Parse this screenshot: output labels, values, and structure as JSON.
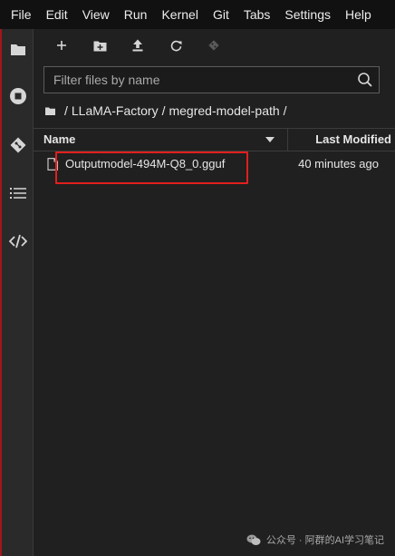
{
  "menubar": {
    "items": [
      "File",
      "Edit",
      "View",
      "Run",
      "Kernel",
      "Git",
      "Tabs",
      "Settings",
      "Help"
    ]
  },
  "sidebar": {
    "icons": [
      "folder-icon",
      "running-icon",
      "git-icon",
      "toc-icon",
      "extensions-icon"
    ]
  },
  "toolbar": {
    "icons": [
      "new-launcher-icon",
      "new-folder-icon",
      "upload-icon",
      "refresh-icon",
      "git-clone-icon"
    ]
  },
  "search": {
    "placeholder": "Filter files by name",
    "value": ""
  },
  "breadcrumb": {
    "root_icon": "folder-icon",
    "parts": [
      "LLaMA-Factory",
      "megred-model-path"
    ],
    "separator": "/"
  },
  "listing": {
    "columns": {
      "name": "Name",
      "last_modified": "Last Modified"
    },
    "files": [
      {
        "name": "Outputmodel-494M-Q8_0.gguf",
        "modified": "40 minutes ago",
        "icon": "file-icon"
      }
    ]
  },
  "colors": {
    "menubar_bg": "#111111",
    "panel_bg": "#202020",
    "sidebar_bg": "#2a2a2a",
    "active_border": "#a3161c",
    "highlight_box": "#e0201e"
  },
  "watermark": {
    "text": "公众号 · 阿群的AI学习笔记",
    "icon": "wechat-icon"
  }
}
